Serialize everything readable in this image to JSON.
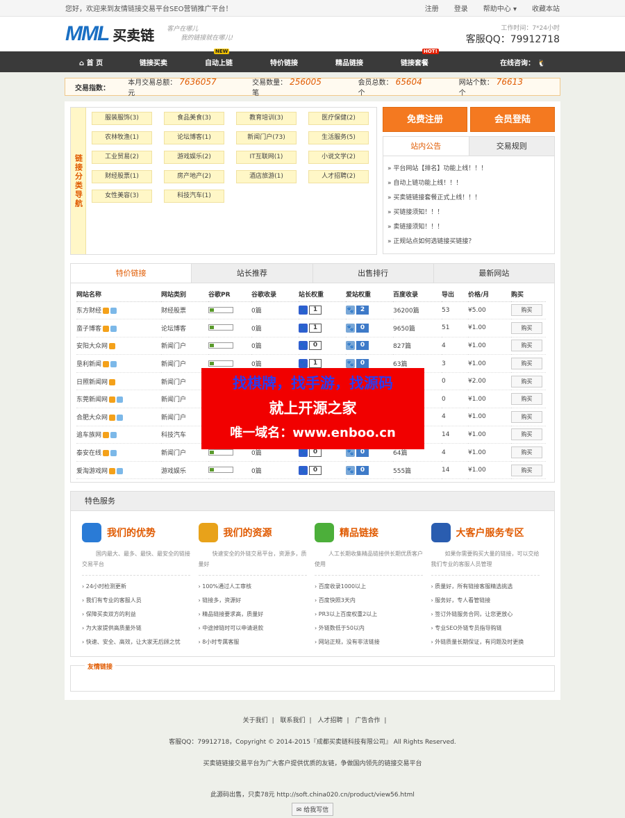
{
  "top": {
    "welcome": "您好，欢迎来到友情链接交易平台SEO营销推广平台！",
    "links": [
      "注册",
      "登录",
      "帮助中心 ▾",
      "收藏本站"
    ]
  },
  "header": {
    "logo_en": "MML",
    "logo_cn": "买卖链",
    "slogan1": "客户在哪儿",
    "slogan2": "我的链接就在哪儿!",
    "worktime": "工作时间：7*24小时",
    "qq": "客服QQ：79912718"
  },
  "nav": {
    "items": [
      "首 页",
      "链接买卖",
      "自动上链",
      "特价链接",
      "精品链接",
      "链接套餐"
    ],
    "consult": "在线咨询：",
    "badge_new": "NEW",
    "badge_hot": "HOT!"
  },
  "stats": {
    "label": "交易指数：",
    "items": [
      {
        "k": "本月交易总额：",
        "v": "7636057",
        "u": "元"
      },
      {
        "k": "交易数量：",
        "v": "256005",
        "u": "笔"
      },
      {
        "k": "会员总数：",
        "v": "65604",
        "u": "个"
      },
      {
        "k": "网站个数：",
        "v": "76613",
        "u": "个"
      }
    ]
  },
  "catnav": {
    "title": "链接分类导航",
    "items": [
      "服装服饰(3)",
      "食品美食(3)",
      "教育培训(3)",
      "医疗保健(2)",
      "农林牧渔(1)",
      "论坛博客(1)",
      "新闻门户(73)",
      "生活服务(5)",
      "工业贸易(2)",
      "游戏娱乐(2)",
      "IT互联网(1)",
      "小说文学(2)",
      "财经股票(1)",
      "房产地产(2)",
      "酒店旅游(1)",
      "人才招聘(2)",
      "女性美容(3)",
      "科技汽车(1)"
    ]
  },
  "buttons": {
    "register": "免费注册",
    "login": "会员登陆"
  },
  "notice": {
    "tabs": [
      "站内公告",
      "交易规则"
    ],
    "items": [
      "» 平台网站【排名】功能上线！！！",
      "» 自动上链功能上线！！！",
      "» 买卖链链接套餐正式上线！！！",
      "» 买链接须知！！！",
      "» 卖链接须知！！！",
      "» 正规站点如何选链接买链接？"
    ]
  },
  "table": {
    "tabs": [
      "特价链接",
      "站长推荐",
      "出售排行",
      "最新网站"
    ],
    "headers": [
      "网站名称",
      "网站类别",
      "谷歌PR",
      "谷歌收录",
      "站长权重",
      "爱站权重",
      "百度收录",
      "导出",
      "价格/月",
      "购买"
    ],
    "rows": [
      {
        "name": "东方财经",
        "cat": "财经股票",
        "pr": "0",
        "g": "0篇",
        "w1": "1",
        "w2": "2",
        "bd": "36200篇",
        "out": "53",
        "price": "¥5.00",
        "buy": "购买"
      },
      {
        "name": "蛮子博客",
        "cat": "论坛博客",
        "pr": "0",
        "g": "0篇",
        "w1": "1",
        "w2": "0",
        "bd": "9650篇",
        "out": "51",
        "price": "¥1.00",
        "buy": "购买"
      },
      {
        "name": "安阳大众网",
        "cat": "新闻门户",
        "pr": "0",
        "g": "0篇",
        "w1": "0",
        "w2": "0",
        "bd": "827篇",
        "out": "4",
        "price": "¥1.00",
        "buy": "购买"
      },
      {
        "name": "垦利新闻",
        "cat": "新闻门户",
        "pr": "0",
        "g": "0篇",
        "w1": "1",
        "w2": "0",
        "bd": "63篇",
        "out": "3",
        "price": "¥1.00",
        "buy": "购买"
      },
      {
        "name": "日照新闻网",
        "cat": "新闻门户",
        "pr": "0",
        "g": "",
        "w1": "",
        "w2": "",
        "bd": "",
        "out": "0",
        "price": "¥2.00",
        "buy": "购买"
      },
      {
        "name": "东莞新闻网",
        "cat": "新闻门户",
        "pr": "0",
        "g": "",
        "w1": "",
        "w2": "",
        "bd": "",
        "out": "0",
        "price": "¥1.00",
        "buy": "购买"
      },
      {
        "name": "合肥大众网",
        "cat": "新闻门户",
        "pr": "0",
        "g": "",
        "w1": "",
        "w2": "",
        "bd": "",
        "out": "4",
        "price": "¥1.00",
        "buy": "购买"
      },
      {
        "name": "追车族网",
        "cat": "科技汽车",
        "pr": "0",
        "g": "",
        "w1": "",
        "w2": "",
        "bd": "",
        "out": "14",
        "price": "¥1.00",
        "buy": "购买"
      },
      {
        "name": "泰安在线",
        "cat": "新闻门户",
        "pr": "0",
        "g": "0篇",
        "w1": "0",
        "w2": "0",
        "bd": "64篇",
        "out": "4",
        "price": "¥1.00",
        "buy": "购买"
      },
      {
        "name": "爱淘游戏网",
        "cat": "游戏娱乐",
        "pr": "0",
        "g": "0篇",
        "w1": "0",
        "w2": "0",
        "bd": "555篇",
        "out": "14",
        "price": "¥1.00",
        "buy": "购买"
      }
    ]
  },
  "ad": {
    "l1": "找棋牌，找手游，找源码",
    "l2": "就上开源之家",
    "l3": "唯一域名：www.enboo.cn"
  },
  "service": {
    "title": "特色服务",
    "cols": [
      {
        "title": "我们的优势",
        "desc": "国内最大、最多、最快、最安全的链接交易平台",
        "items": [
          "› 24小时检测更新",
          "› 我们有专业的客服人员",
          "› 保障买卖双方的利益",
          "› 为大家提供高质量外链",
          "› 快速、安全、高效，让大家无后顾之忧"
        ]
      },
      {
        "title": "我们的资源",
        "desc": "快速安全的外链交易平台，资源多，质量好",
        "items": [
          "› 100%通过人工审核",
          "› 链接多，资源好",
          "› 精品链接要求高，质量好",
          "› 中途掉链时可以申请退款",
          "› 8小时专属客服"
        ]
      },
      {
        "title": "精品链接",
        "desc": "人工长期收集精品链接供长期优质客户使用",
        "items": [
          "› 百度收录1000以上",
          "› 百度快照3天内",
          "› PR3以上百度权重2以上",
          "› 外链数低于50以内",
          "› 网站正规，没有非法链接"
        ]
      },
      {
        "title": "大客户服务专区",
        "desc": "如果你需要购买大量的链接，可以交给我们专业的客服人员管理",
        "items": [
          "› 质量好，所有链接客服精选挑选",
          "› 服务好，专人看管链接",
          "› 签订外链服务合同，让您更放心",
          "› 专业SEO外链专员指导购链",
          "› 外链质量长期保证，有问题及时更换"
        ]
      }
    ]
  },
  "friend": {
    "title": "友情链接"
  },
  "footer": {
    "links": [
      "关于我们",
      "联系我们",
      "人才招聘",
      "广告合作"
    ],
    "copyright": "客服QQ：79912718，Copyright © 2014-2015『成都买卖链科技有限公司』 All Rights Reserved.",
    "desc": "买卖链链接交易平台为广大客户提供优质的友链，争做国内领先的链接交易平台",
    "source": "此源码出售，只卖78元  http://soft.china020.cn/product/view56.html",
    "mail": "给我写信"
  }
}
